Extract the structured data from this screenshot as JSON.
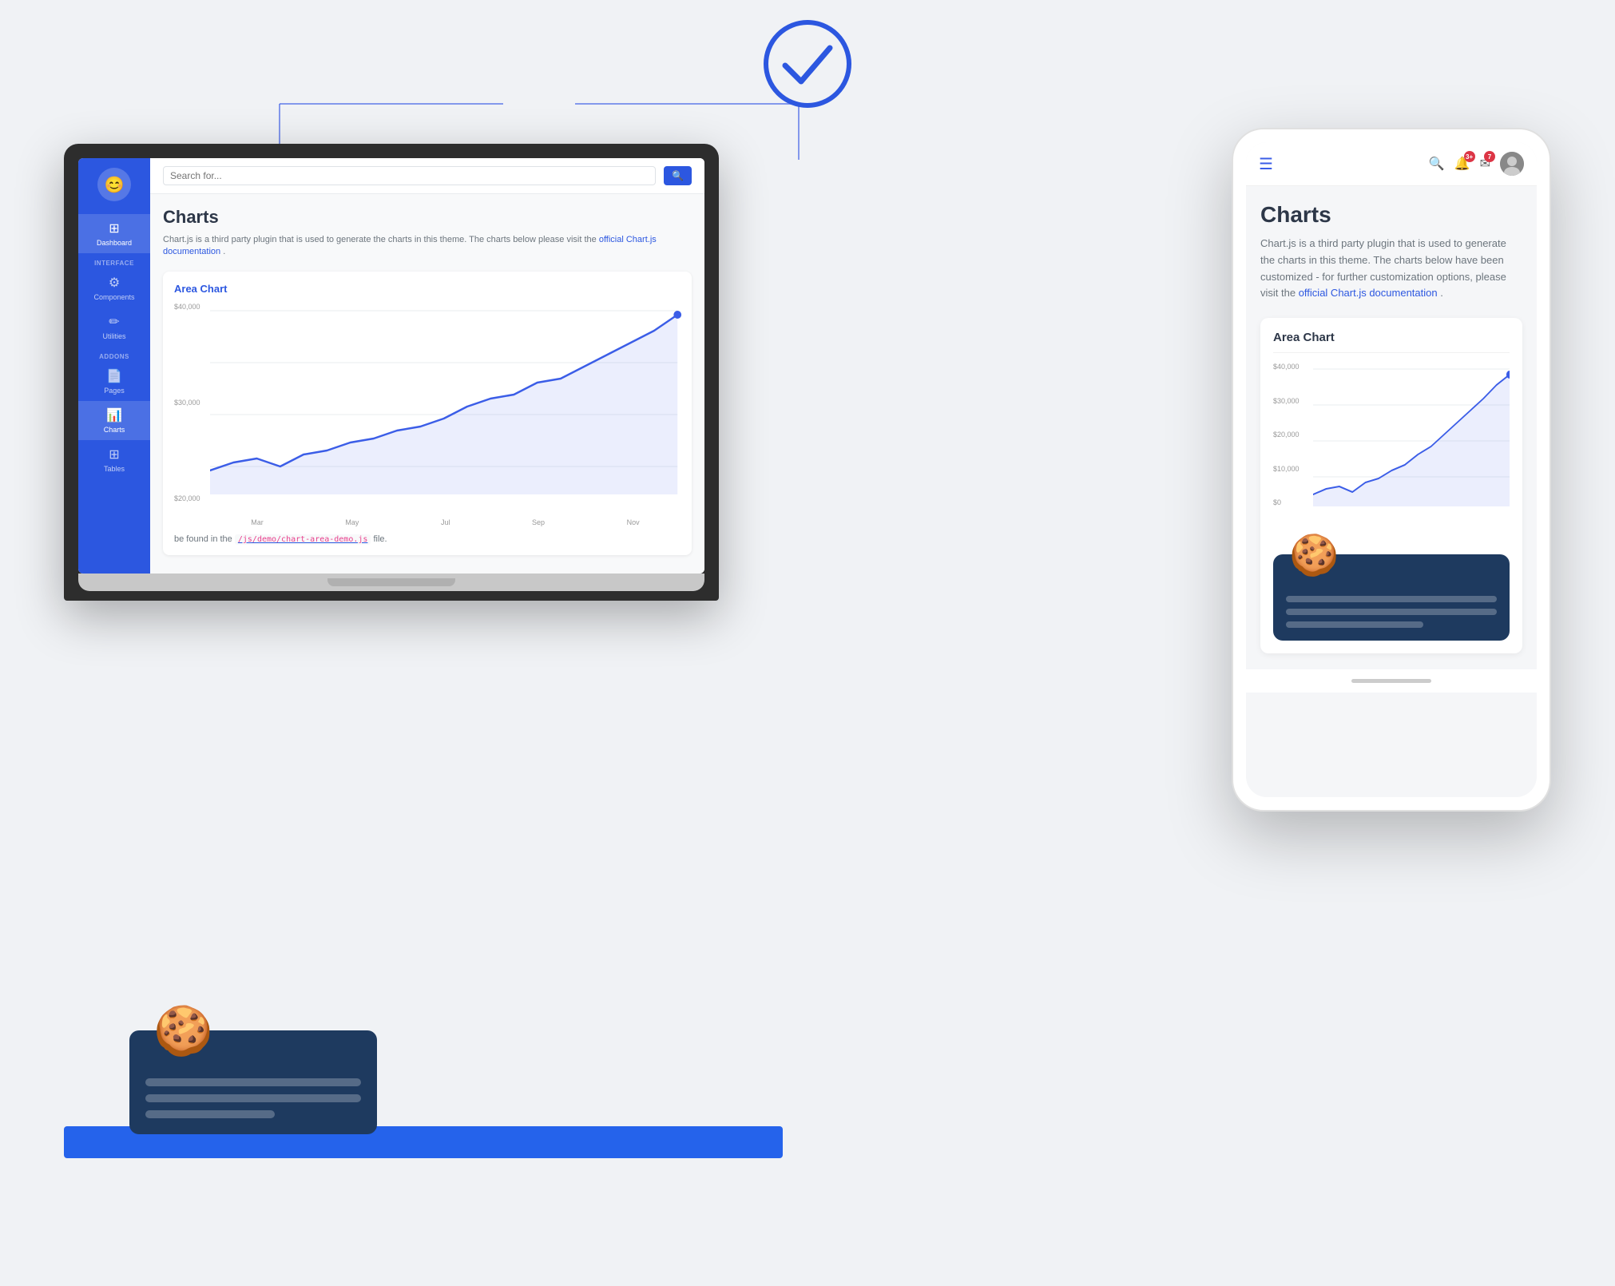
{
  "page": {
    "title": "Charts",
    "description_part1": "Chart.js is a third party plugin that is used to generate the charts in this theme. The charts below",
    "description_part2": "please visit the",
    "description_link": "official Chart.js documentation",
    "description_end": ".",
    "area_chart_label": "Area Chart",
    "demo_note_pre": "be found in the",
    "demo_file": "/js/demo/chart-area-demo.js",
    "demo_note_post": "file."
  },
  "sidebar": {
    "logo_icon": "😊",
    "sections": [
      {
        "label": "Dashboard",
        "icon": "⊞",
        "active": true
      },
      {
        "section_name": "INTERFACE"
      },
      {
        "label": "Components",
        "icon": "⚙"
      },
      {
        "label": "Utilities",
        "icon": "✏"
      },
      {
        "section_name": "ADDONS"
      },
      {
        "label": "Pages",
        "icon": "📄"
      },
      {
        "label": "Charts",
        "icon": "📊",
        "active": true
      },
      {
        "label": "Tables",
        "icon": "⊞"
      }
    ]
  },
  "topbar": {
    "search_placeholder": "Search for...",
    "search_button_icon": "🔍"
  },
  "phone_topbar": {
    "menu_icon": "☰",
    "search_icon": "🔍",
    "notifications_count": "3+",
    "messages_count": "7",
    "avatar_icon": "👤"
  },
  "phone_page": {
    "title": "Charts",
    "description": "Chart.js is a third party plugin that is used to generate the charts in this theme. The charts below have been customized - for further customization options, please visit the",
    "doc_link": "official Chart.js documentation",
    "doc_link_end": ".",
    "area_chart_label": "Area Chart"
  },
  "chart": {
    "y_labels": [
      "$40,000",
      "$30,000",
      "$20,000",
      "$10,000",
      "$0"
    ],
    "x_labels": [
      "Mar",
      "May",
      "Jul",
      "Sep",
      "Nov"
    ],
    "color": "#3b5de7"
  },
  "checkmark": {
    "color": "#2c57e0"
  }
}
